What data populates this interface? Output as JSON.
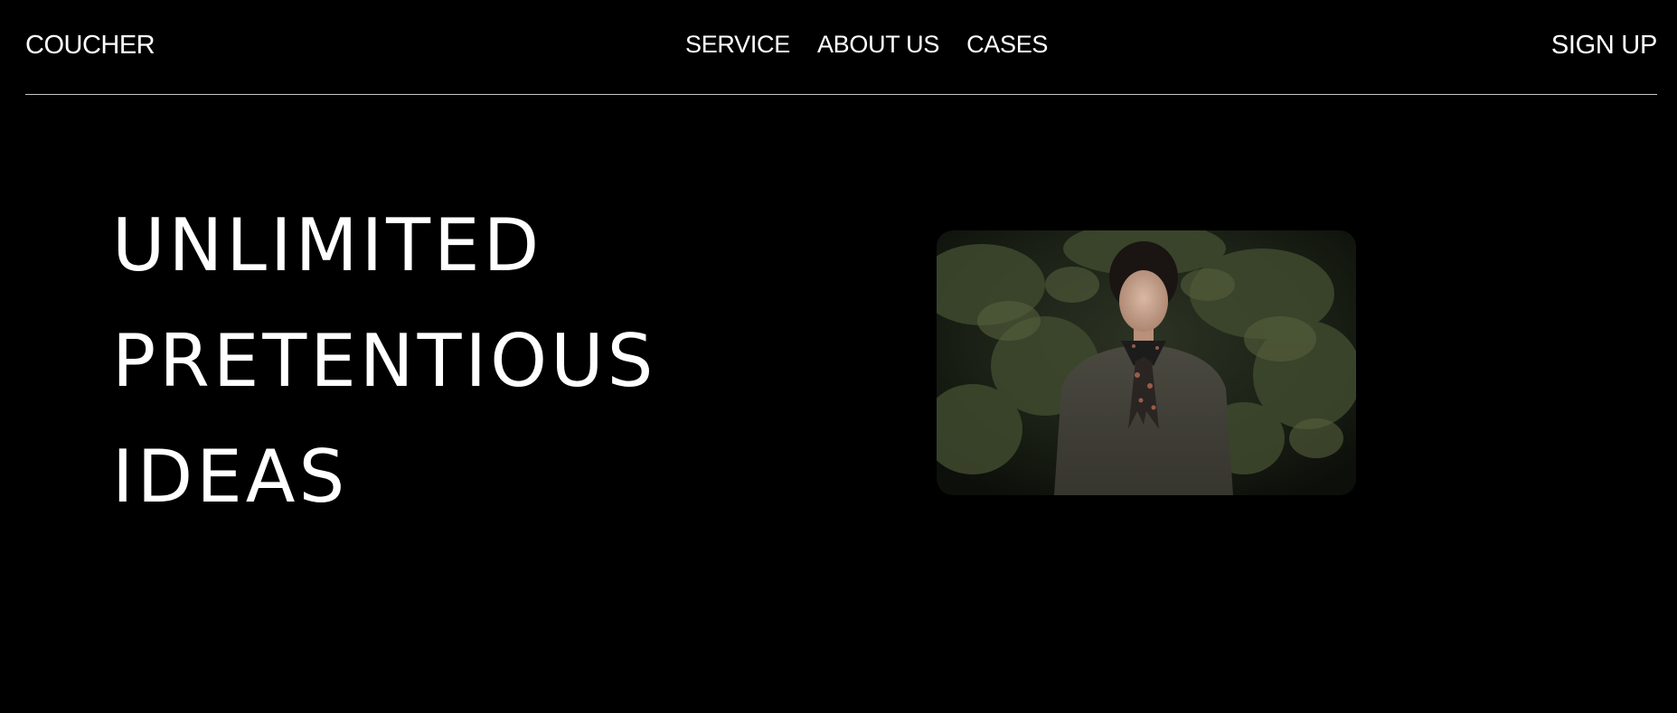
{
  "nav": {
    "brand": "COUCHER",
    "items": [
      {
        "label": "SERVICE"
      },
      {
        "label": "ABOUT US"
      },
      {
        "label": "CASES"
      }
    ],
    "signup_label": "SIGN UP"
  },
  "hero": {
    "heading_lines": [
      "UNLIMITED",
      "PRETENTIOUS",
      "IDEAS"
    ]
  },
  "colors": {
    "background": "#000000",
    "text": "#ffffff",
    "divider": "#c9c9c9"
  }
}
